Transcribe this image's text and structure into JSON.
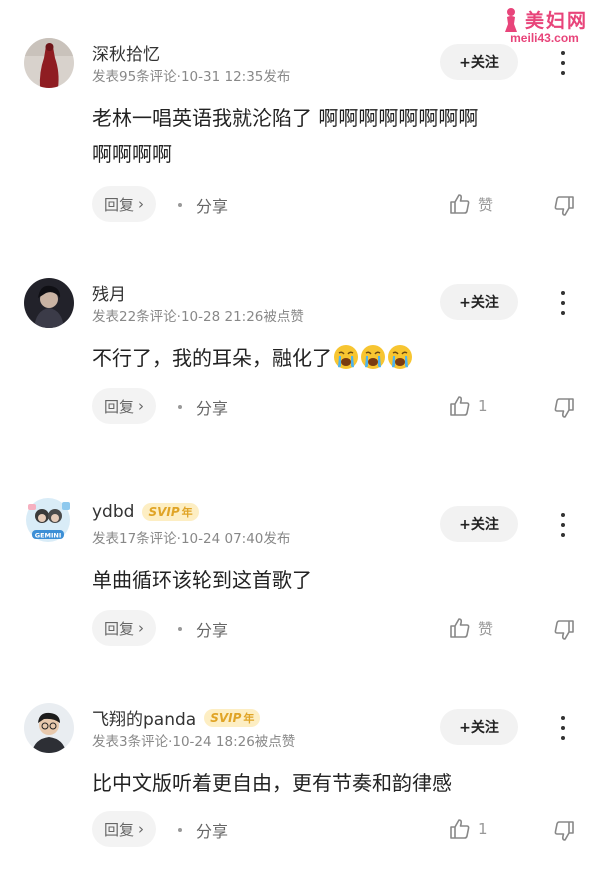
{
  "watermark": {
    "title": "美妇网",
    "url": "meili43.com"
  },
  "icons": {
    "like": "thumbs-up-icon",
    "dislike": "thumbs-down-icon",
    "more": "more-vertical-icon",
    "emoji": "loudly-crying-face-emoji"
  },
  "comments": [
    {
      "username": "深秋拾忆",
      "svip": false,
      "meta": "发表95条评论·10-31 12:35发布",
      "follow_label": "+关注",
      "text_lines": [
        "老林一唱英语我就沦陷了 啊啊啊啊啊啊啊啊",
        "啊啊啊啊"
      ],
      "reply_label": "回复",
      "share_label": "分享",
      "like_label": "赞"
    },
    {
      "username": "残月",
      "svip": false,
      "meta": "发表22条评论·10-28 21:26被点赞",
      "follow_label": "+关注",
      "text_lines": [
        "不行了，我的耳朵，融化了"
      ],
      "emoji_count": 3,
      "reply_label": "回复",
      "share_label": "分享",
      "like_label": "1"
    },
    {
      "username": "ydbd",
      "svip": true,
      "svip_label": "SVIP",
      "svip_year": "年",
      "meta": "发表17条评论·10-24 07:40发布",
      "follow_label": "+关注",
      "text_lines": [
        "单曲循环该轮到这首歌了"
      ],
      "reply_label": "回复",
      "share_label": "分享",
      "like_label": "赞"
    },
    {
      "username": "飞翔的panda",
      "svip": true,
      "svip_label": "SVIP",
      "svip_year": "年",
      "meta": "发表3条评论·10-24 18:26被点赞",
      "follow_label": "+关注",
      "text_lines": [
        "比中文版听着更自由，更有节奏和韵律感"
      ],
      "reply_label": "回复",
      "share_label": "分享",
      "like_label": "1"
    }
  ]
}
